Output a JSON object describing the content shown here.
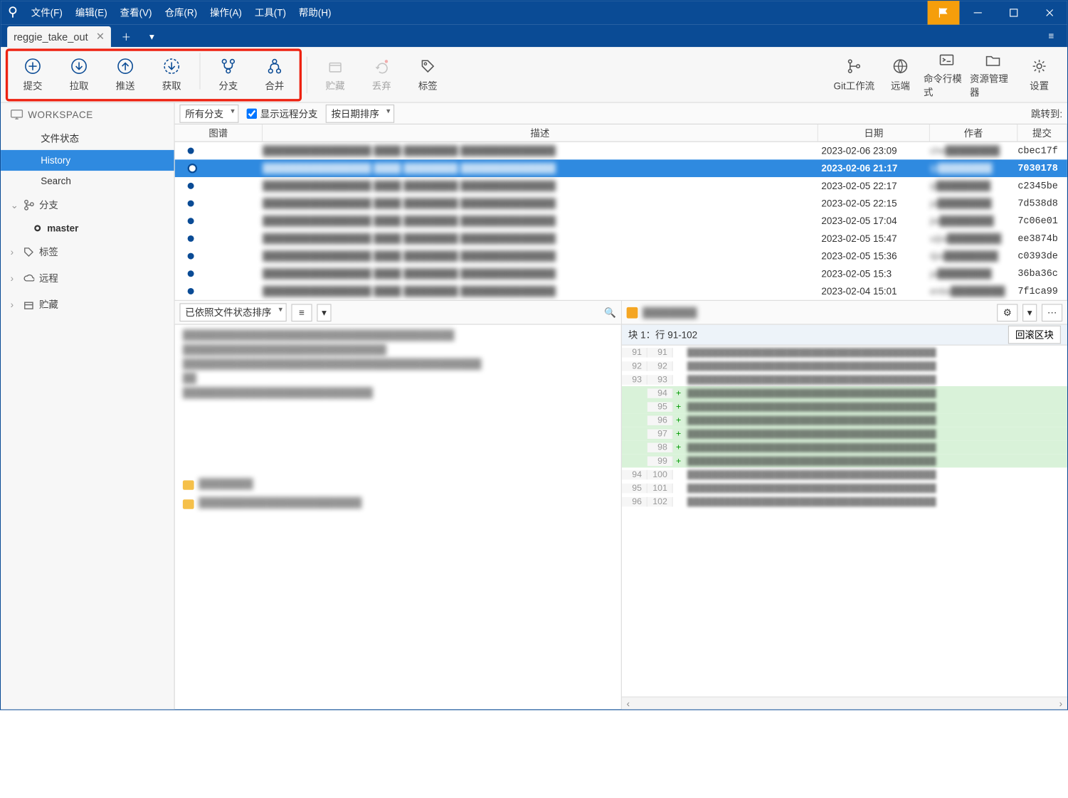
{
  "menu": {
    "file": "文件(F)",
    "edit": "编辑(E)",
    "view": "查看(V)",
    "repo": "仓库(R)",
    "action": "操作(A)",
    "tool": "工具(T)",
    "help": "帮助(H)"
  },
  "tab": {
    "name": "reggie_take_out"
  },
  "toolbar": {
    "commit": "提交",
    "pull": "拉取",
    "push": "推送",
    "fetch": "获取",
    "branch": "分支",
    "merge": "合并",
    "stash": "贮藏",
    "discard": "丢弃",
    "tag": "标签",
    "gitflow": "Git工作流",
    "remote": "远端",
    "terminal": "命令行模式",
    "explorer": "资源管理器",
    "settings": "设置"
  },
  "filter": {
    "allBranches": "所有分支",
    "showRemote": "显示远程分支",
    "sortDate": "按日期排序",
    "jump": "跳转到:"
  },
  "cols": {
    "graph": "图谱",
    "desc": "描述",
    "date": "日期",
    "author": "作者",
    "commit": "提交"
  },
  "sidebar": {
    "workspace": "WORKSPACE",
    "fileStatus": "文件状态",
    "history": "History",
    "search": "Search",
    "branches": "分支",
    "master": "master",
    "tags": "标签",
    "remotes": "远程",
    "stashes": "贮藏"
  },
  "commits": [
    {
      "date": "2023-02-06 23:09",
      "author": "che",
      "hash": "cbec17f"
    },
    {
      "date": "2023-02-06 21:17",
      "author": "iji",
      "hash": "7030178",
      "selected": true
    },
    {
      "date": "2023-02-05 22:17",
      "author": "iji",
      "hash": "c2345be"
    },
    {
      "date": "2023-02-05 22:15",
      "author": "ja",
      "hash": "7d538d8"
    },
    {
      "date": "2023-02-05 17:04",
      "author": "jia",
      "hash": "7c06e01"
    },
    {
      "date": "2023-02-05 15:47",
      "author": "uijia",
      "hash": "ee3874b"
    },
    {
      "date": "2023-02-05 15:36",
      "author": "iijia",
      "hash": "c0393de"
    },
    {
      "date": "2023-02-05 15:3",
      "author": "ja",
      "hash": "36ba36c"
    },
    {
      "date": "2023-02-04 15:01",
      "author": "entia",
      "hash": "7f1ca99"
    }
  ],
  "filesort": "已依照文件状态排序",
  "diff": {
    "hunk": "块 1：行 91-102",
    "revert": "回滚区块",
    "lines": [
      {
        "o": "91",
        "n": "91",
        "t": "ctx"
      },
      {
        "o": "92",
        "n": "92",
        "t": "ctx"
      },
      {
        "o": "93",
        "n": "93",
        "t": "ctx"
      },
      {
        "o": "",
        "n": "94",
        "t": "add"
      },
      {
        "o": "",
        "n": "95",
        "t": "add"
      },
      {
        "o": "",
        "n": "96",
        "t": "add"
      },
      {
        "o": "",
        "n": "97",
        "t": "add"
      },
      {
        "o": "",
        "n": "98",
        "t": "add"
      },
      {
        "o": "",
        "n": "99",
        "t": "add"
      },
      {
        "o": "94",
        "n": "100",
        "t": "ctx"
      },
      {
        "o": "95",
        "n": "101",
        "t": "ctx"
      },
      {
        "o": "96",
        "n": "102",
        "t": "ctx"
      }
    ]
  }
}
